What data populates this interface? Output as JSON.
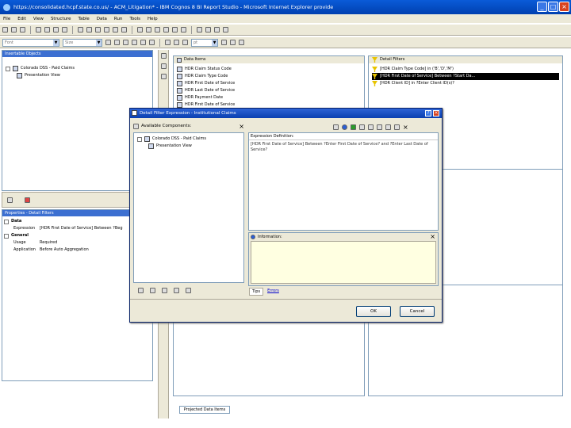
{
  "window": {
    "title": "https://consolidated.hcpf.state.co.us/ - ACM_Litigation* - IBM Cognos 8 BI Report Studio - Microsoft Internet Explorer provide"
  },
  "menu": [
    "File",
    "Edit",
    "View",
    "Structure",
    "Table",
    "Data",
    "Run",
    "Tools",
    "Help"
  ],
  "toolbar2": {
    "font_value": "Font",
    "size_value": "Size",
    "pt_value": "pt"
  },
  "insertable": {
    "header": "Insertable Objects",
    "items": [
      "Colorado DSS - Paid Claims",
      "Presentation View"
    ]
  },
  "properties": {
    "header": "Properties - Detail Filters",
    "sections": [
      {
        "name": "Data",
        "rows": [
          {
            "key": "Expression",
            "value": "[HDR First Date of Service] Between ?Beg"
          }
        ]
      },
      {
        "name": "General",
        "rows": [
          {
            "key": "Usage",
            "value": "Required"
          },
          {
            "key": "Application",
            "value": "Before Auto Aggregation"
          }
        ]
      }
    ]
  },
  "data_items": {
    "header": "Data Items",
    "items": [
      "HDR Claim Status Code",
      "HDR Claim Type Code",
      "HDR First Date of Service",
      "HDR Last Date of Service",
      "HDR Payment Date",
      "HDR First Date of Service"
    ]
  },
  "detail_filters": {
    "header": "Detail Filters",
    "items": [
      {
        "label": "[HDR Claim Type Code] in ('B','D','M')",
        "selected": false
      },
      {
        "label": "[HDR First Date of Service] Between ?Start Da...",
        "selected": true
      },
      {
        "label": "[HDR Client ID] in ?Enter Client ID(s)?",
        "selected": false
      }
    ]
  },
  "bottom_tab": "Projected Data Items",
  "dialog": {
    "title": "Detail Filter Expression - Institutional Claims",
    "available_components": "Available Components:",
    "tree": [
      "Colorado DSS - Paid Claims",
      "Presentation View"
    ],
    "expr_label": "Expression Definition:",
    "expr_text": "[HDR First Date of Service] Between ?Enter First Date of Service? and ?Enter Last Date of Service?",
    "info_label": "Information:",
    "tabs": [
      "Tips",
      "Errors"
    ],
    "ok": "OK",
    "cancel": "Cancel"
  }
}
